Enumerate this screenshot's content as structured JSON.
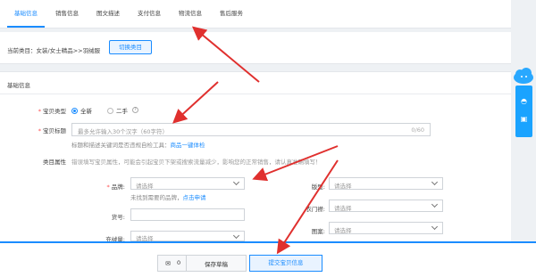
{
  "tabs": [
    {
      "label": "基础信息",
      "active": true
    },
    {
      "label": "销售信息"
    },
    {
      "label": "图文描述"
    },
    {
      "label": "支付信息"
    },
    {
      "label": "物流信息"
    },
    {
      "label": "售后服务"
    }
  ],
  "category": {
    "current_label": "当前类目：女装/女士精品>>羽绒服",
    "switch_button": "切换类目"
  },
  "basic_info": {
    "section_title": "基础信息",
    "item_type": {
      "label": "宝贝类型",
      "options": [
        "全新",
        "二手"
      ],
      "selected": "全新"
    },
    "item_title": {
      "label": "宝贝标题",
      "placeholder": "最多允许输入30个汉字（60字符）",
      "counter": "0/60",
      "hint_text": "标题和描述关键词是否违规自检工具：",
      "hint_link": "商品一键体检"
    },
    "attributes": {
      "label": "类目属性",
      "hint": "错误填写宝贝属性，可能会引起宝贝下架或搜索流量减少，影响您的正常销售，请认真准确填写！",
      "brand": {
        "label": "品牌:",
        "placeholder": "请选择",
        "not_found": "未找到需要的品牌，",
        "apply_link": "点击申请"
      },
      "model": {
        "label": "货号:"
      },
      "fill": {
        "label": "充绒量:",
        "placeholder": "请选择"
      },
      "style": {
        "label": "版型:",
        "placeholder": "请选择"
      },
      "length": {
        "label": "衣门襟:",
        "placeholder": "请选择"
      },
      "pattern": {
        "label": "图案:",
        "placeholder": "请选择"
      }
    }
  },
  "footer": {
    "draft_count": "0",
    "save_draft": "保存草稿",
    "submit": "提交宝贝信息"
  },
  "colors": {
    "accent": "#1a8cff",
    "required": "#ff4d4f",
    "arrow": "#e0302e"
  }
}
